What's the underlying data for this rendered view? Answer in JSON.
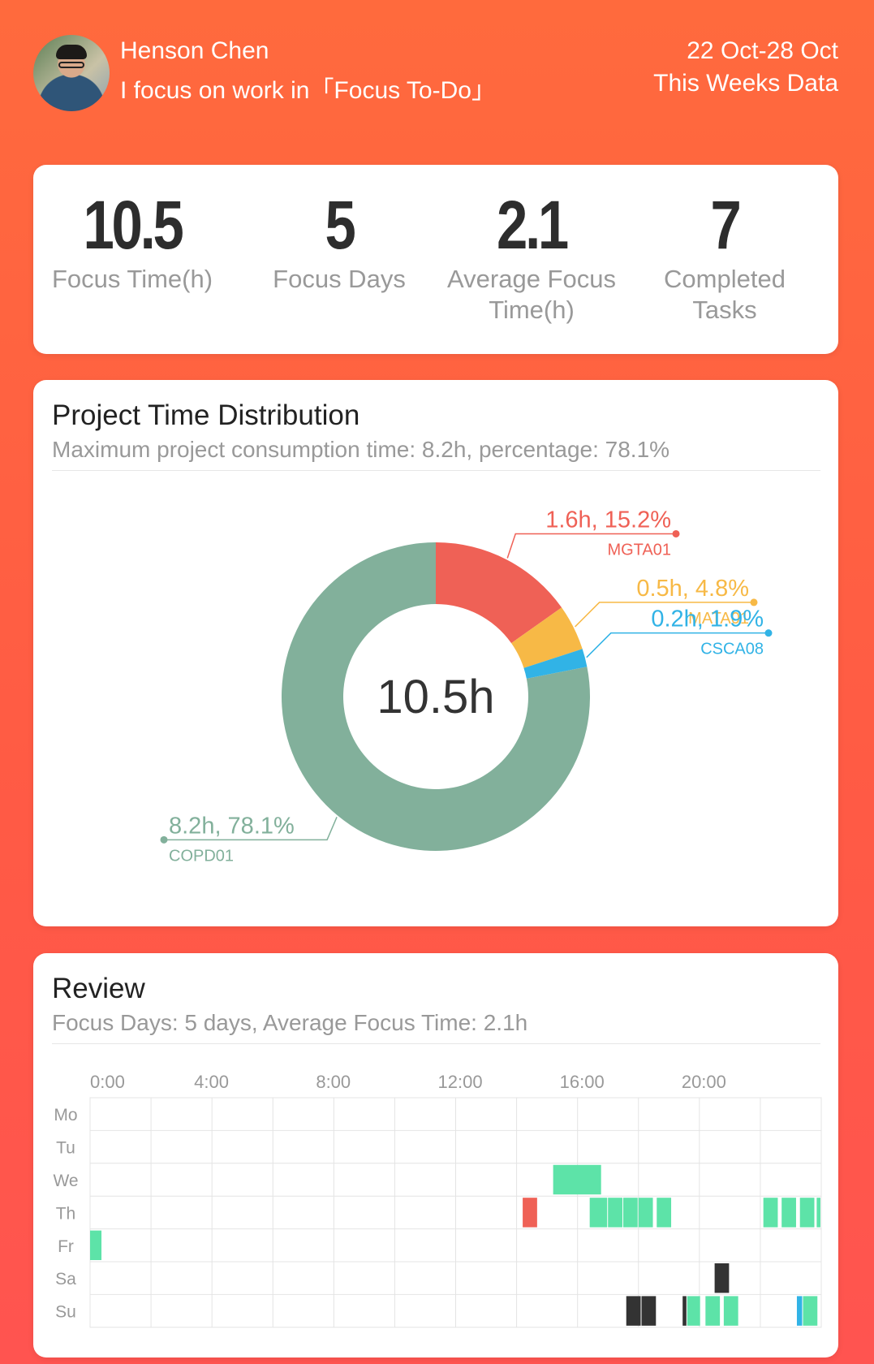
{
  "header": {
    "user_name": "Henson Chen",
    "user_status": "I focus on work in「Focus To-Do」",
    "date_range": "22 Oct-28 Oct",
    "period_label": "This Weeks Data"
  },
  "stats": [
    {
      "value": "10.5",
      "label": "Focus Time(h)"
    },
    {
      "value": "5",
      "label": "Focus Days"
    },
    {
      "value": "2.1",
      "label": "Average Focus Time(h)"
    },
    {
      "value": "7",
      "label": "Completed Tasks"
    }
  ],
  "distribution": {
    "title": "Project Time Distribution",
    "subtitle": "Maximum project consumption time: 8.2h, percentage: 78.1%",
    "center_label": "10.5h"
  },
  "chart_data": [
    {
      "type": "pie",
      "title": "Project Time Distribution",
      "center_label": "10.5h",
      "slices": [
        {
          "name": "MGTA01",
          "hours": 1.6,
          "percent": 15.2,
          "label": "1.6h, 15.2%",
          "color": "#ef6156"
        },
        {
          "name": "MATA01",
          "hours": 0.5,
          "percent": 4.8,
          "label": "0.5h, 4.8%",
          "color": "#f7b946"
        },
        {
          "name": "CSCA08",
          "hours": 0.2,
          "percent": 1.9,
          "label": "0.2h, 1.9%",
          "color": "#31b3e6"
        },
        {
          "name": "COPD01",
          "hours": 8.2,
          "percent": 78.1,
          "label": "8.2h, 78.1%",
          "color": "#82b09b"
        }
      ]
    },
    {
      "type": "heatmap",
      "title": "Review",
      "x_ticks": [
        "0:00",
        "4:00",
        "8:00",
        "12:00",
        "16:00",
        "20:00"
      ],
      "days": [
        "Mo",
        "Tu",
        "We",
        "Th",
        "Fr",
        "Sa",
        "Su"
      ],
      "x_range_hours": [
        0,
        24
      ],
      "sessions": [
        {
          "day": "We",
          "start": 15.2,
          "end": 16.8,
          "color": "#5de3a8"
        },
        {
          "day": "Th",
          "start": 14.2,
          "end": 14.7,
          "color": "#ef6156"
        },
        {
          "day": "Th",
          "start": 16.4,
          "end": 17.0,
          "color": "#5de3a8"
        },
        {
          "day": "Th",
          "start": 17.0,
          "end": 17.5,
          "color": "#5de3a8"
        },
        {
          "day": "Th",
          "start": 17.5,
          "end": 18.0,
          "color": "#5de3a8"
        },
        {
          "day": "Th",
          "start": 18.0,
          "end": 18.5,
          "color": "#5de3a8"
        },
        {
          "day": "Th",
          "start": 18.6,
          "end": 19.1,
          "color": "#5de3a8"
        },
        {
          "day": "Th",
          "start": 22.1,
          "end": 22.6,
          "color": "#5de3a8"
        },
        {
          "day": "Th",
          "start": 22.7,
          "end": 23.2,
          "color": "#5de3a8"
        },
        {
          "day": "Th",
          "start": 23.3,
          "end": 23.8,
          "color": "#5de3a8"
        },
        {
          "day": "Th",
          "start": 23.85,
          "end": 24.0,
          "color": "#5de3a8"
        },
        {
          "day": "Fr",
          "start": 0.0,
          "end": 0.4,
          "color": "#5de3a8"
        },
        {
          "day": "Sa",
          "start": 20.5,
          "end": 21.0,
          "color": "#333333"
        },
        {
          "day": "Su",
          "start": 17.6,
          "end": 18.1,
          "color": "#333333"
        },
        {
          "day": "Su",
          "start": 18.1,
          "end": 18.6,
          "color": "#333333"
        },
        {
          "day": "Su",
          "start": 19.45,
          "end": 19.6,
          "color": "#333333"
        },
        {
          "day": "Su",
          "start": 19.6,
          "end": 20.05,
          "color": "#5de3a8"
        },
        {
          "day": "Su",
          "start": 20.2,
          "end": 20.7,
          "color": "#5de3a8"
        },
        {
          "day": "Su",
          "start": 20.8,
          "end": 21.3,
          "color": "#5de3a8"
        },
        {
          "day": "Su",
          "start": 23.2,
          "end": 23.4,
          "color": "#31b3e6"
        },
        {
          "day": "Su",
          "start": 23.4,
          "end": 23.9,
          "color": "#5de3a8"
        }
      ]
    }
  ],
  "review": {
    "title": "Review",
    "subtitle": "Focus Days: 5 days, Average Focus Time: 2.1h"
  },
  "colors": {
    "background_top": "#ff6a3d",
    "background_bottom": "#ff5450",
    "session_focus": "#5de3a8"
  }
}
